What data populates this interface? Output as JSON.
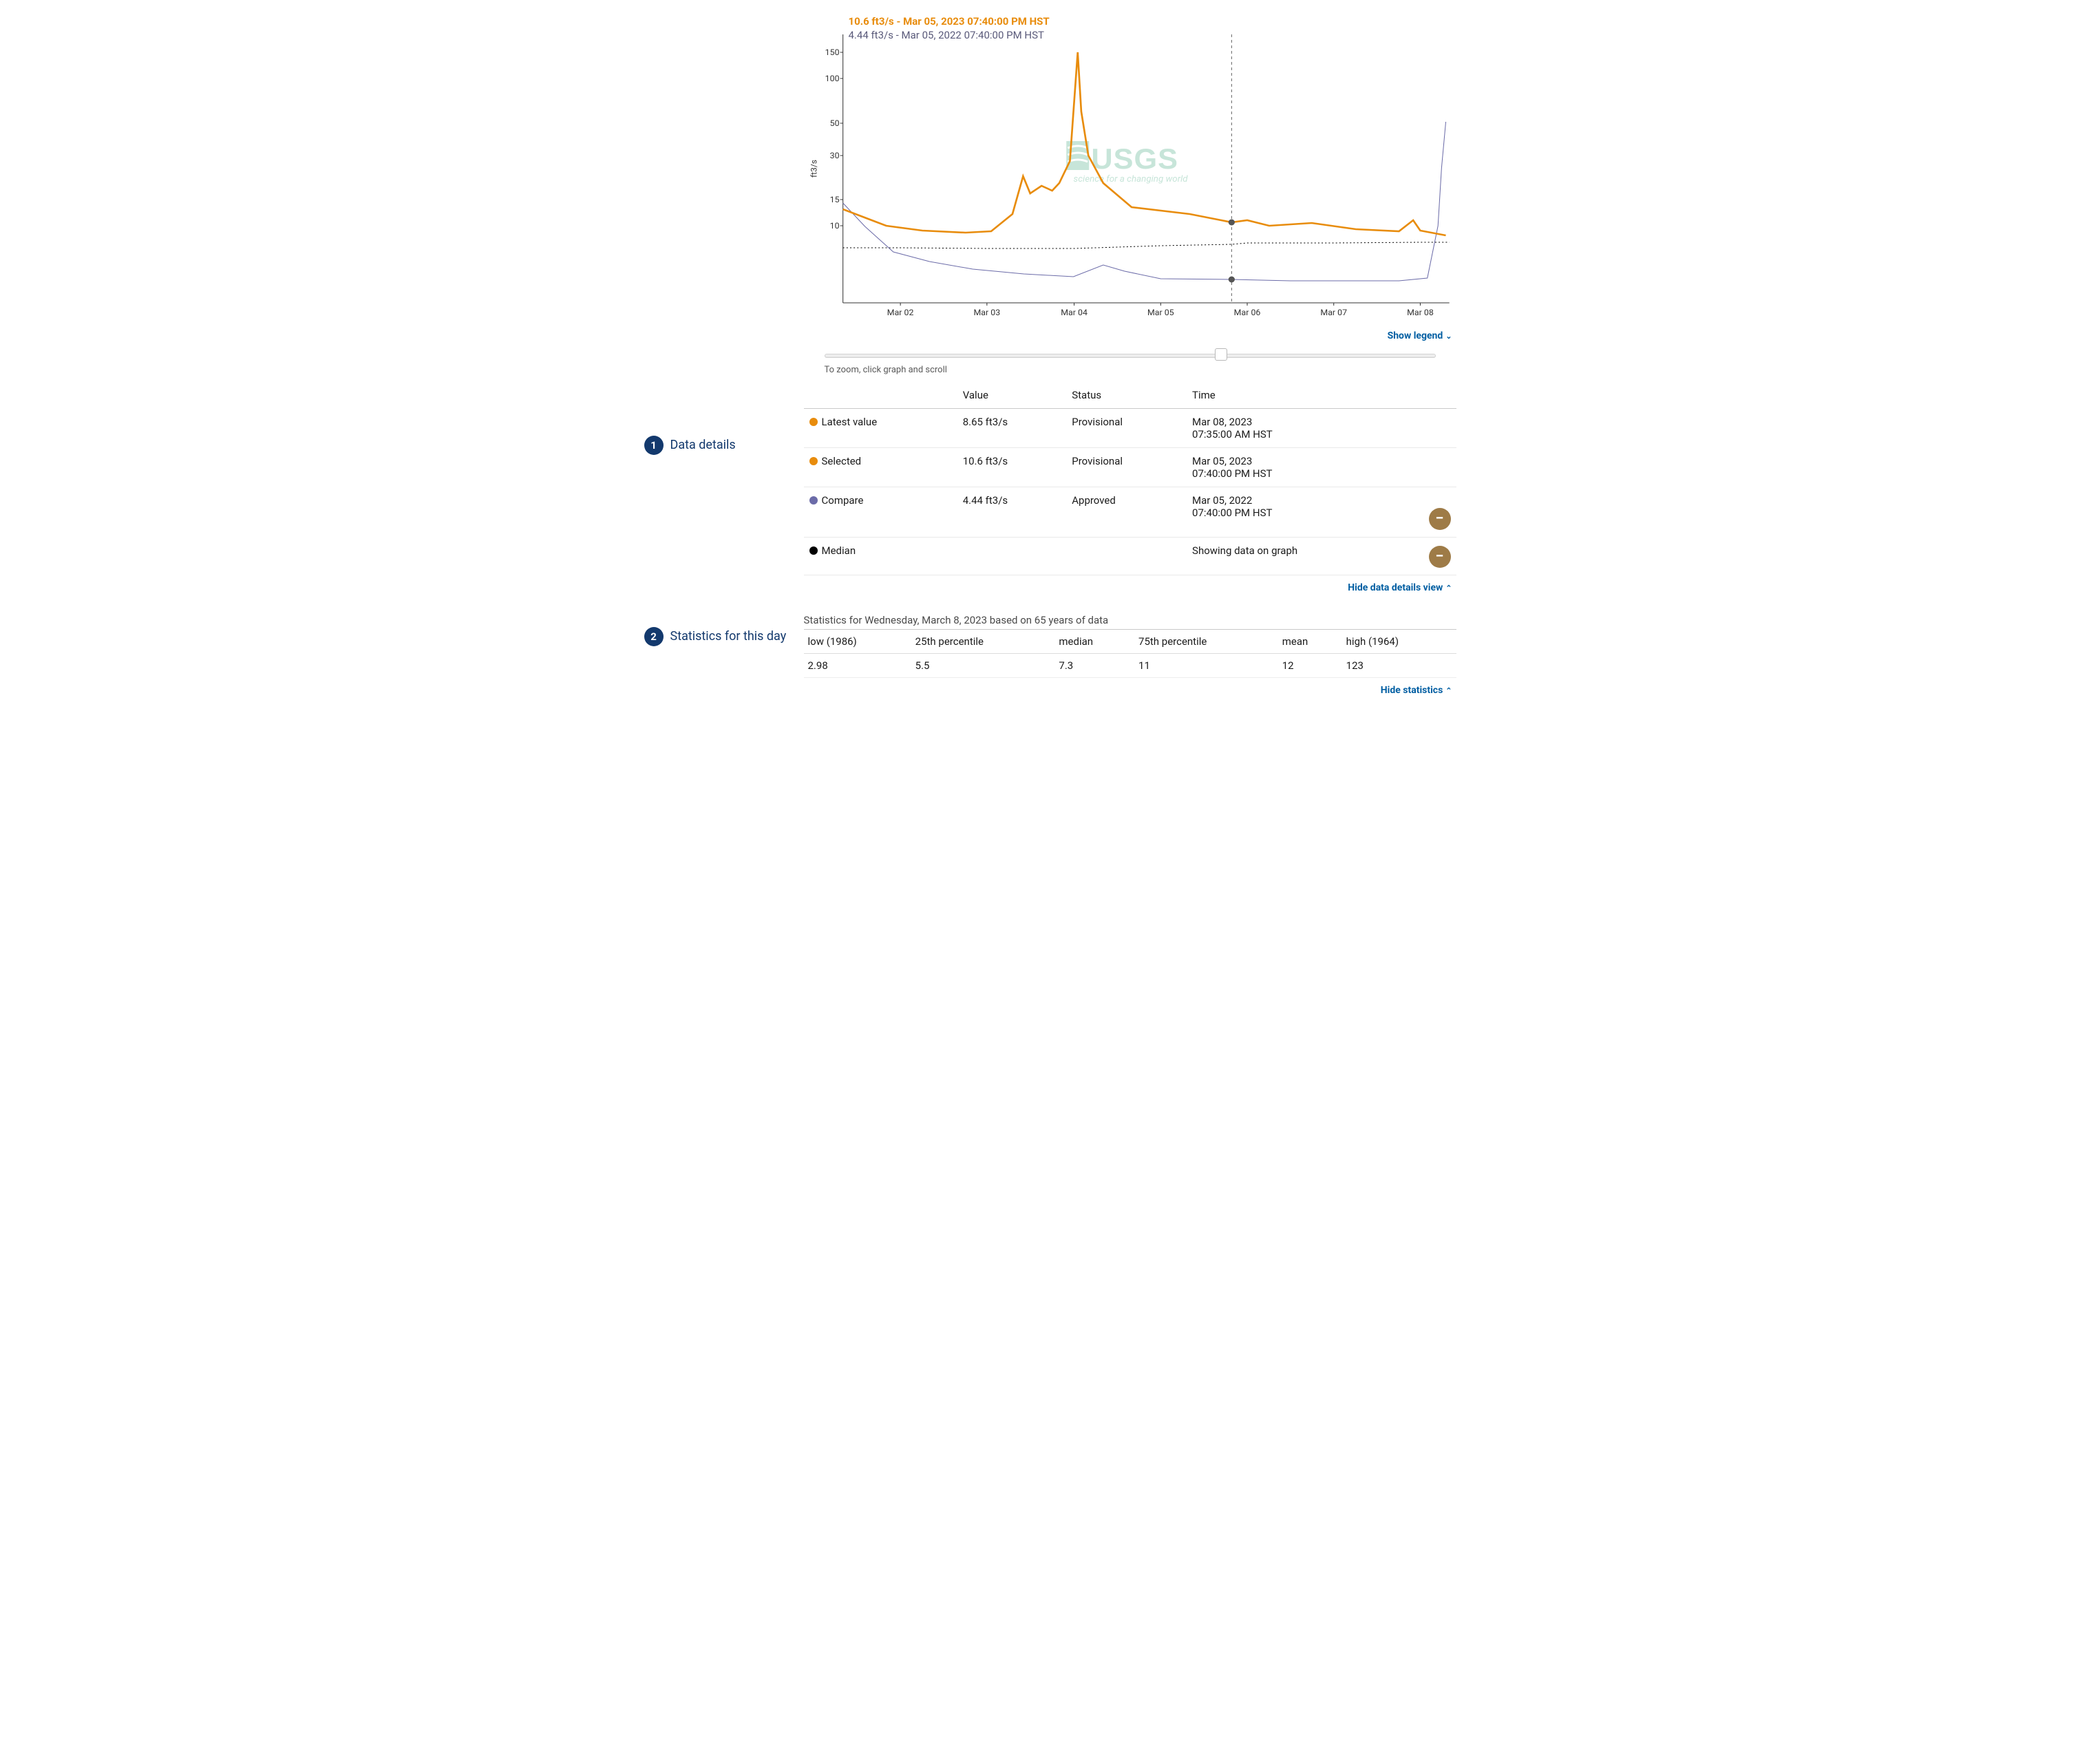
{
  "chart_data": {
    "type": "line",
    "ylabel": "ft3/s",
    "yscale": "log",
    "yticks": [
      10,
      15,
      30,
      50,
      100,
      150
    ],
    "xlabel": "",
    "xticks": [
      "Mar 02",
      "Mar 03",
      "Mar 04",
      "Mar 05",
      "Mar 06",
      "Mar 07",
      "Mar 08"
    ],
    "x_range": [
      "2023-03-01T08:00",
      "2023-03-08T08:00"
    ],
    "cursor_x": "2023-03-05T19:40",
    "cursor_points": [
      {
        "series": "current",
        "value": 10.6
      },
      {
        "series": "compare",
        "value": 4.44
      }
    ],
    "series": [
      {
        "name": "current",
        "label": "2023",
        "color": "#e88c0c",
        "stroke_width": 2.4,
        "points": [
          {
            "x": "2023-03-01T08:00",
            "y": 13
          },
          {
            "x": "2023-03-01T20:00",
            "y": 10
          },
          {
            "x": "2023-03-02T06:00",
            "y": 9.3
          },
          {
            "x": "2023-03-02T18:00",
            "y": 9
          },
          {
            "x": "2023-03-03T03:00",
            "y": 9.2
          },
          {
            "x": "2023-03-03T09:00",
            "y": 12
          },
          {
            "x": "2023-03-03T12:00",
            "y": 22
          },
          {
            "x": "2023-03-03T14:00",
            "y": 17
          },
          {
            "x": "2023-03-03T17:00",
            "y": 19
          },
          {
            "x": "2023-03-03T20:00",
            "y": 18
          },
          {
            "x": "2023-03-03T22:00",
            "y": 20
          },
          {
            "x": "2023-03-04T01:00",
            "y": 28
          },
          {
            "x": "2023-03-04T03:00",
            "y": 150
          },
          {
            "x": "2023-03-04T04:00",
            "y": 60
          },
          {
            "x": "2023-03-04T06:00",
            "y": 30
          },
          {
            "x": "2023-03-04T10:00",
            "y": 20
          },
          {
            "x": "2023-03-04T18:00",
            "y": 14
          },
          {
            "x": "2023-03-05T06:00",
            "y": 12
          },
          {
            "x": "2023-03-05T19:40",
            "y": 10.6
          },
          {
            "x": "2023-03-06T00:00",
            "y": 11
          },
          {
            "x": "2023-03-06T06:00",
            "y": 10.2
          },
          {
            "x": "2023-03-06T18:00",
            "y": 10.5
          },
          {
            "x": "2023-03-07T06:00",
            "y": 9.5
          },
          {
            "x": "2023-03-07T18:00",
            "y": 9.2
          },
          {
            "x": "2023-03-07T22:00",
            "y": 11
          },
          {
            "x": "2023-03-08T00:00",
            "y": 9.4
          },
          {
            "x": "2023-03-08T07:35",
            "y": 8.65
          }
        ]
      },
      {
        "name": "compare",
        "label": "2022",
        "color": "#6b6ba8",
        "stroke_width": 1,
        "points": [
          {
            "x": "2022-03-01T08:00",
            "y": 14
          },
          {
            "x": "2022-03-01T14:00",
            "y": 9
          },
          {
            "x": "2022-03-01T22:00",
            "y": 6.7
          },
          {
            "x": "2022-03-02T08:00",
            "y": 5.8
          },
          {
            "x": "2022-03-02T20:00",
            "y": 5.2
          },
          {
            "x": "2022-03-03T12:00",
            "y": 4.8
          },
          {
            "x": "2022-03-04T00:00",
            "y": 4.6
          },
          {
            "x": "2022-03-04T08:00",
            "y": 5.4
          },
          {
            "x": "2022-03-04T14:00",
            "y": 5.0
          },
          {
            "x": "2022-03-05T00:00",
            "y": 4.5
          },
          {
            "x": "2022-03-05T19:40",
            "y": 4.44
          },
          {
            "x": "2022-03-06T12:00",
            "y": 4.3
          },
          {
            "x": "2022-03-07T06:00",
            "y": 4.3
          },
          {
            "x": "2022-03-07T20:00",
            "y": 4.3
          },
          {
            "x": "2022-03-08T02:00",
            "y": 4.5
          },
          {
            "x": "2022-03-08T05:00",
            "y": 10
          },
          {
            "x": "2022-03-08T06:00",
            "y": 25
          },
          {
            "x": "2022-03-08T07:00",
            "y": 42
          }
        ]
      },
      {
        "name": "median",
        "label": "Median",
        "color": "#000000",
        "style": "dotted",
        "stroke_width": 1,
        "points": [
          {
            "x": "2023-03-01T08:00",
            "y": 7.3
          },
          {
            "x": "2023-03-02T00:00",
            "y": 7.3
          },
          {
            "x": "2023-03-03T00:00",
            "y": 7.2
          },
          {
            "x": "2023-03-04T00:00",
            "y": 7.2
          },
          {
            "x": "2023-03-05T00:00",
            "y": 7.5
          },
          {
            "x": "2023-03-06T00:00",
            "y": 7.7
          },
          {
            "x": "2023-03-07T00:00",
            "y": 7.7
          },
          {
            "x": "2023-03-08T00:00",
            "y": 7.8
          },
          {
            "x": "2023-03-08T08:00",
            "y": 7.8
          }
        ]
      }
    ],
    "watermark": "USGS"
  },
  "callouts": {
    "current": "10.6 ft3/s - Mar 05, 2023 07:40:00 PM HST",
    "compare": "4.44 ft3/s - Mar 05, 2022 07:40:00 PM HST"
  },
  "links": {
    "show_legend": "Show legend",
    "hide_details": "Hide data details view",
    "hide_stats": "Hide statistics"
  },
  "zoom_hint": "To zoom, click graph and scroll",
  "details": {
    "headers": [
      "",
      "Value",
      "Status",
      "Time"
    ],
    "rows": [
      {
        "dot": "#e88c0c",
        "label": "Latest value",
        "value": "8.65 ft3/s",
        "status": "Provisional",
        "time": "Mar 08, 2023\n07:35:00 AM HST",
        "removable": false
      },
      {
        "dot": "#e88c0c",
        "label": "Selected",
        "value": "10.6 ft3/s",
        "status": "Provisional",
        "time": "Mar 05, 2023\n07:40:00 PM HST",
        "removable": false
      },
      {
        "dot": "#6b6ba8",
        "label": "Compare",
        "value": "4.44 ft3/s",
        "status": "Approved",
        "time": "Mar 05, 2022\n07:40:00 PM HST",
        "removable": true
      },
      {
        "dot": "#000000",
        "label": "Median",
        "value": "",
        "status": "",
        "time": "Showing data on graph",
        "removable": true
      }
    ]
  },
  "annotations": {
    "one": {
      "num": "1",
      "text": "Data details"
    },
    "two": {
      "num": "2",
      "text": "Statistics for this day"
    }
  },
  "stats": {
    "title": "Statistics for Wednesday, March 8, 2023 based on 65 years of data",
    "headers": [
      "low (1986)",
      "25th percentile",
      "median",
      "75th percentile",
      "mean",
      "high (1964)"
    ],
    "values": [
      "2.98",
      "5.5",
      "7.3",
      "11",
      "12",
      "123"
    ]
  },
  "slider": {
    "position_pct": 64
  }
}
